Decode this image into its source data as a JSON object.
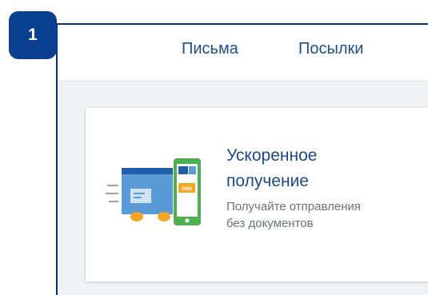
{
  "step": {
    "number": "1"
  },
  "nav": {
    "letters": "Письма",
    "parcels": "Посылки"
  },
  "card": {
    "title_line1": "Ускоренное",
    "title_line2": "получение",
    "desc_line1": "Получайте отправления",
    "desc_line2": "без документов",
    "illustration": {
      "sms_text": "SMS",
      "icon": "parcel-truck-phone-icon"
    }
  },
  "colors": {
    "badge": "#0b3f8f",
    "frame": "#0a2f7a",
    "link": "#1f4e8c",
    "phone": "#4caf50",
    "sms": "#f5a623"
  }
}
